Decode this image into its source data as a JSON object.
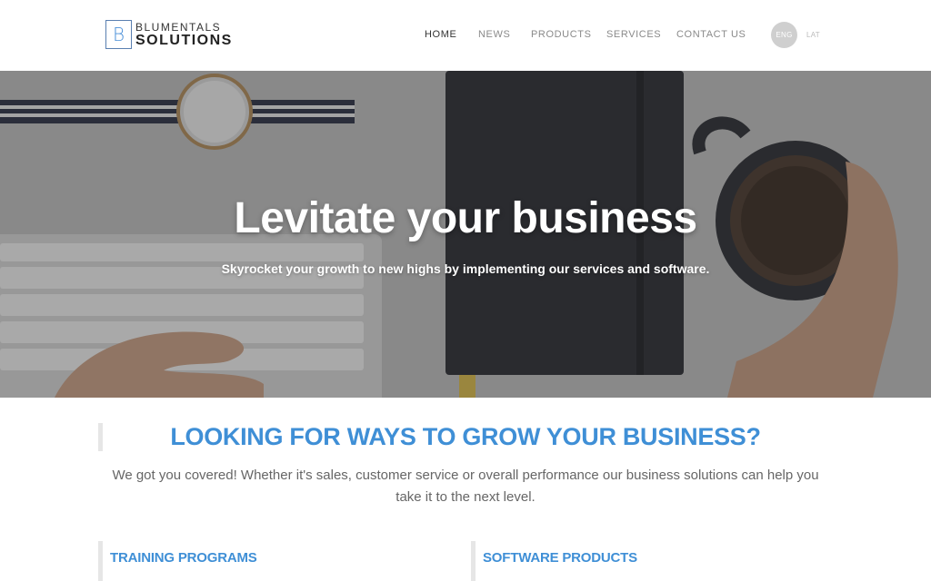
{
  "brand": {
    "logo_letter": "B",
    "name_top": "BLUMENTALS",
    "name_bottom": "SOLUTIONS"
  },
  "nav": {
    "items": [
      {
        "label": "HOME",
        "active": true
      },
      {
        "label": "NEWS",
        "active": false
      },
      {
        "label": "PRODUCTS",
        "active": false
      },
      {
        "label": "SERVICES",
        "active": false
      },
      {
        "label": "CONTACT US",
        "active": false
      }
    ]
  },
  "languages": {
    "current": "ENG",
    "other": "LAT"
  },
  "hero": {
    "title": "Levitate your business",
    "subtitle": "Skyrocket your growth to new highs by implementing our services and software."
  },
  "intro": {
    "heading": "LOOKING FOR WAYS TO GROW YOUR BUSINESS?",
    "text": "We got you covered! Whether it's sales, customer service or overall performance our business solutions can help you take it to the next level."
  },
  "cards": [
    {
      "title": "TRAINING PROGRAMS"
    },
    {
      "title": "SOFTWARE PRODUCTS"
    }
  ],
  "colors": {
    "accent": "#3f8fd6",
    "nav_text": "#8a8a8a",
    "nav_active": "#333333",
    "section_bar": "#e6e6e6"
  }
}
